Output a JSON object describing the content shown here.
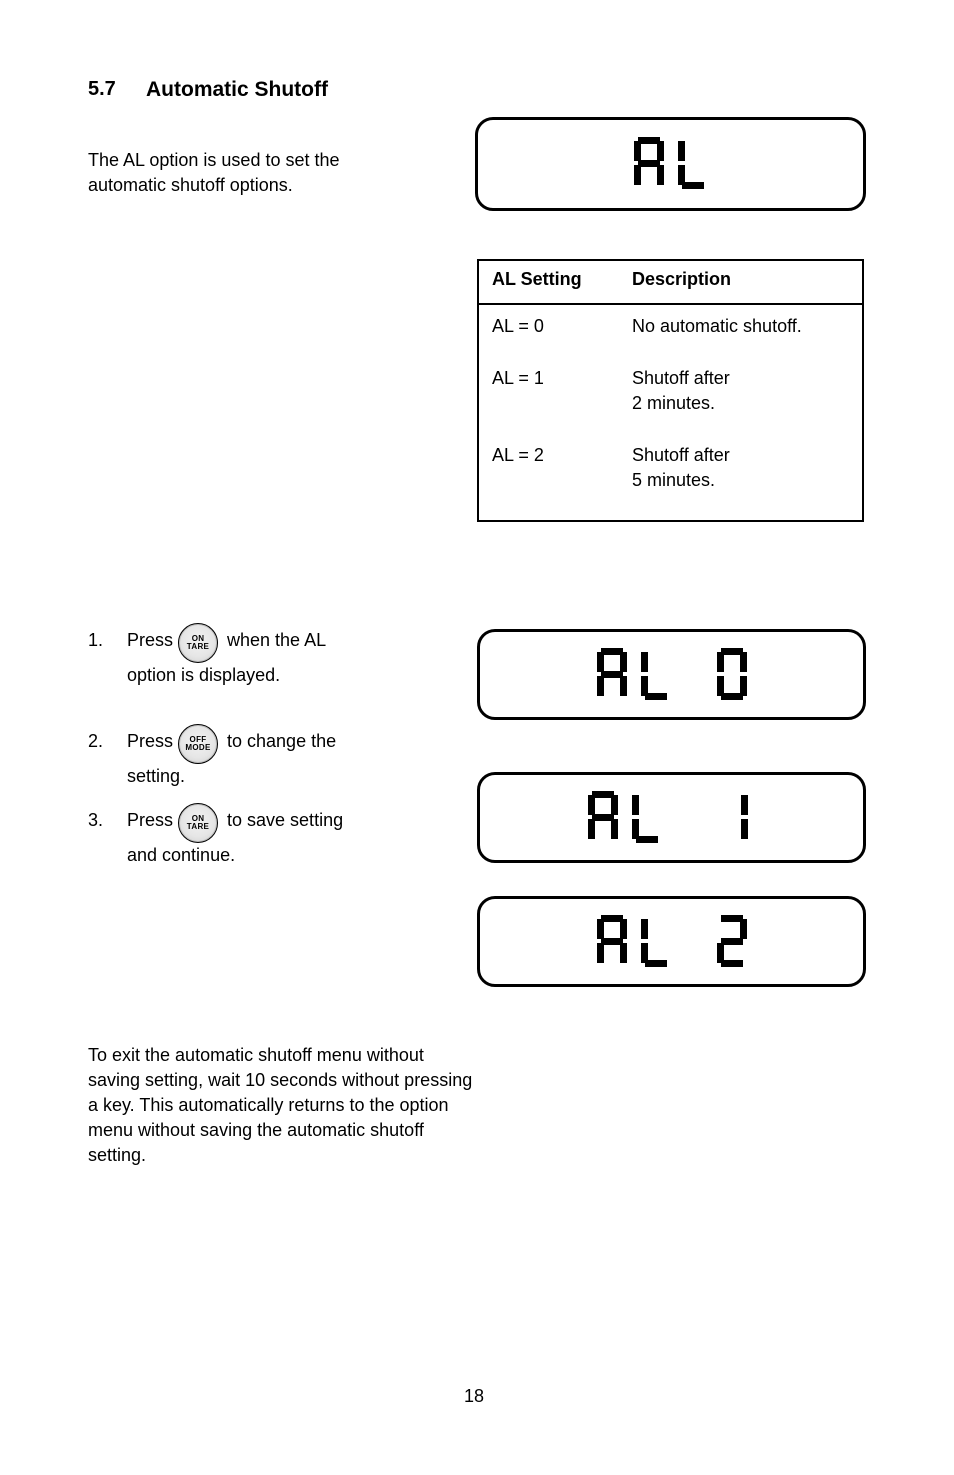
{
  "header": {
    "number": "5.7",
    "title": "Automatic Shutoff",
    "intro_p1": "The AL option is used to set the",
    "intro_p2": "automatic shutoff options."
  },
  "table": {
    "h1": "AL Setting",
    "h2": "Description",
    "r1c1": "AL = 0",
    "r1c2": "No automatic shutoff.",
    "r2c1": "AL = 1",
    "r2c2_l1": "Shutoff after",
    "r2c2_l2": "2 minutes.",
    "r3c1": "AL = 2",
    "r3c2_l1": "Shutoff after",
    "r3c2_l2": "5 minutes."
  },
  "steps": {
    "one_line1": "1.",
    "one_line2": "Press",
    "one_line3": " when the AL",
    "one_line4": "option is displayed.",
    "two_line1": "2.",
    "two_line2": "Press",
    "two_line3": " to change the",
    "two_line4": "setting.",
    "three_line1": "3.",
    "three_line2": "Press",
    "three_line3": " to save setting",
    "three_line4": "and continue.",
    "exit1": "To exit the automatic shutoff menu without",
    "exit2": "saving setting, wait 10 seconds without pressing",
    "exit3": "a key. This automatically returns to the option",
    "exit4": "menu without saving the automatic shutoff",
    "exit5": "setting."
  },
  "buttons": {
    "on": "ON",
    "tare": "TARE",
    "off": "OFF",
    "mode": "MODE"
  },
  "lcd": {
    "al": "AL",
    "d0": "0",
    "d1": "1",
    "d2": "2"
  },
  "page_number": "18"
}
